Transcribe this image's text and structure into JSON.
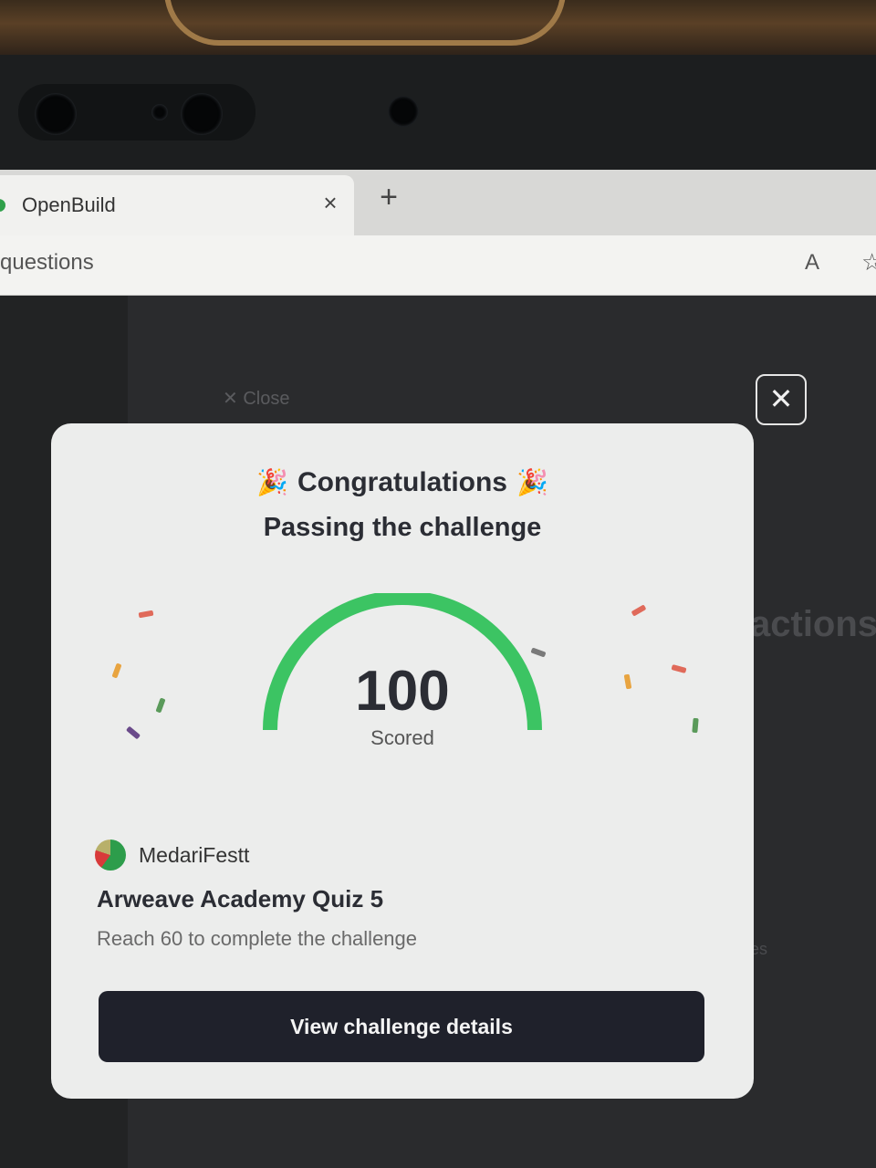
{
  "browser": {
    "tab_title": "OpenBuild",
    "tab_close_glyph": "×",
    "new_tab_glyph": "+",
    "address_text": "questions",
    "read_aloud_glyph": "A",
    "favorite_glyph": "☆"
  },
  "background_page": {
    "close_label": "✕  Close",
    "heading_fragment": "actions",
    "small_fragment": "es"
  },
  "modal": {
    "close_glyph": "✕",
    "title": "Congratulations",
    "title_emoji": "🎉",
    "subtitle": "Passing the challenge",
    "score": "100",
    "score_label": "Scored",
    "score_fraction": 1.0,
    "gauge_color": "#3cc463",
    "author": "MedariFestt",
    "quiz_title": "Arweave Academy Quiz 5",
    "quiz_requirement": "Reach 60 to complete the challenge",
    "cta_label": "View challenge details"
  },
  "icons": {
    "tab_favicon": "openbuild-favicon-icon",
    "tab_close": "close-icon",
    "new_tab": "plus-icon",
    "read_aloud": "read-aloud-icon",
    "favorite": "star-icon",
    "modal_close": "close-icon"
  }
}
